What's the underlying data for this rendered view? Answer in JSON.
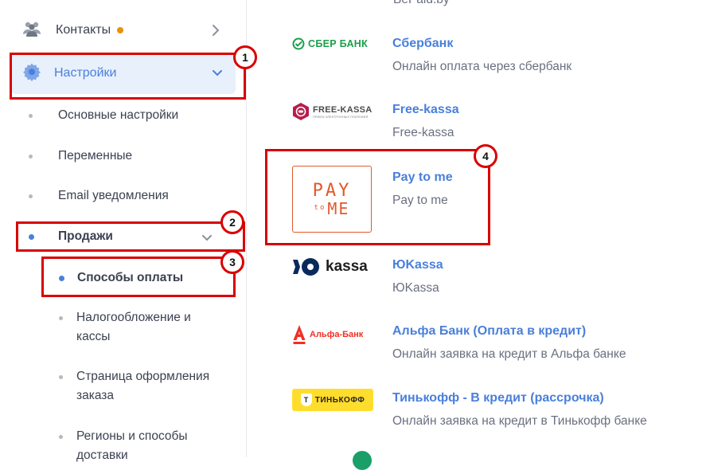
{
  "sidebar": {
    "contacts": {
      "label": "Контакты",
      "badge_color": "#e8910c"
    },
    "settings": {
      "label": "Настройки"
    },
    "sub_items": [
      {
        "label": "Основные настройки"
      },
      {
        "label": "Переменные"
      },
      {
        "label": "Email уведомления"
      },
      {
        "label": "Продажи"
      }
    ],
    "sales_items": [
      {
        "label": "Способы оплаты"
      },
      {
        "label": "Налогообложение и кассы"
      },
      {
        "label": "Страница оформления заказа"
      },
      {
        "label": "Регионы и способы доставки"
      }
    ]
  },
  "payments": {
    "top_cut_text": "BePaid.by",
    "items": [
      {
        "logo_text": "СБЕР БАНК",
        "title": "Сбербанк",
        "desc": "Онлайн оплата через сбербанк"
      },
      {
        "logo_text": "FREE-KASSA",
        "logo_subtext": "ПРИЕМ ЭЛЕКТРОННЫХ ПЛАТЕЖЕЙ",
        "title": "Free-kassa",
        "desc": "Free-kassa"
      },
      {
        "logo_text_top": "PAY",
        "logo_text_mid": "to",
        "logo_text_bottom": "ME",
        "title": "Pay to me",
        "desc": "Pay to me"
      },
      {
        "logo_text": "kassa",
        "title": "ЮKassa",
        "desc": "ЮKassa"
      },
      {
        "logo_text": "Альфа-Банк",
        "title": "Альфа Банк (Оплата в кредит)",
        "desc": "Онлайн заявка на кредит в Альфа банке"
      },
      {
        "logo_text": "ТИНЬКОФФ",
        "title": "Тинькофф - В кредит (рассрочка)",
        "desc": "Онлайн заявка на кредит в Тинькофф банке"
      }
    ]
  },
  "annotations": [
    "1",
    "2",
    "3",
    "4"
  ],
  "colors": {
    "accent": "#4a7fdb",
    "annotation_red": "#d90000",
    "active_bg": "#e8f0fc",
    "sber_green": "#1a9f49",
    "payme_orange": "#e05a2b",
    "alfa_red": "#ef3124",
    "tinkoff_yellow": "#ffdd2d"
  }
}
